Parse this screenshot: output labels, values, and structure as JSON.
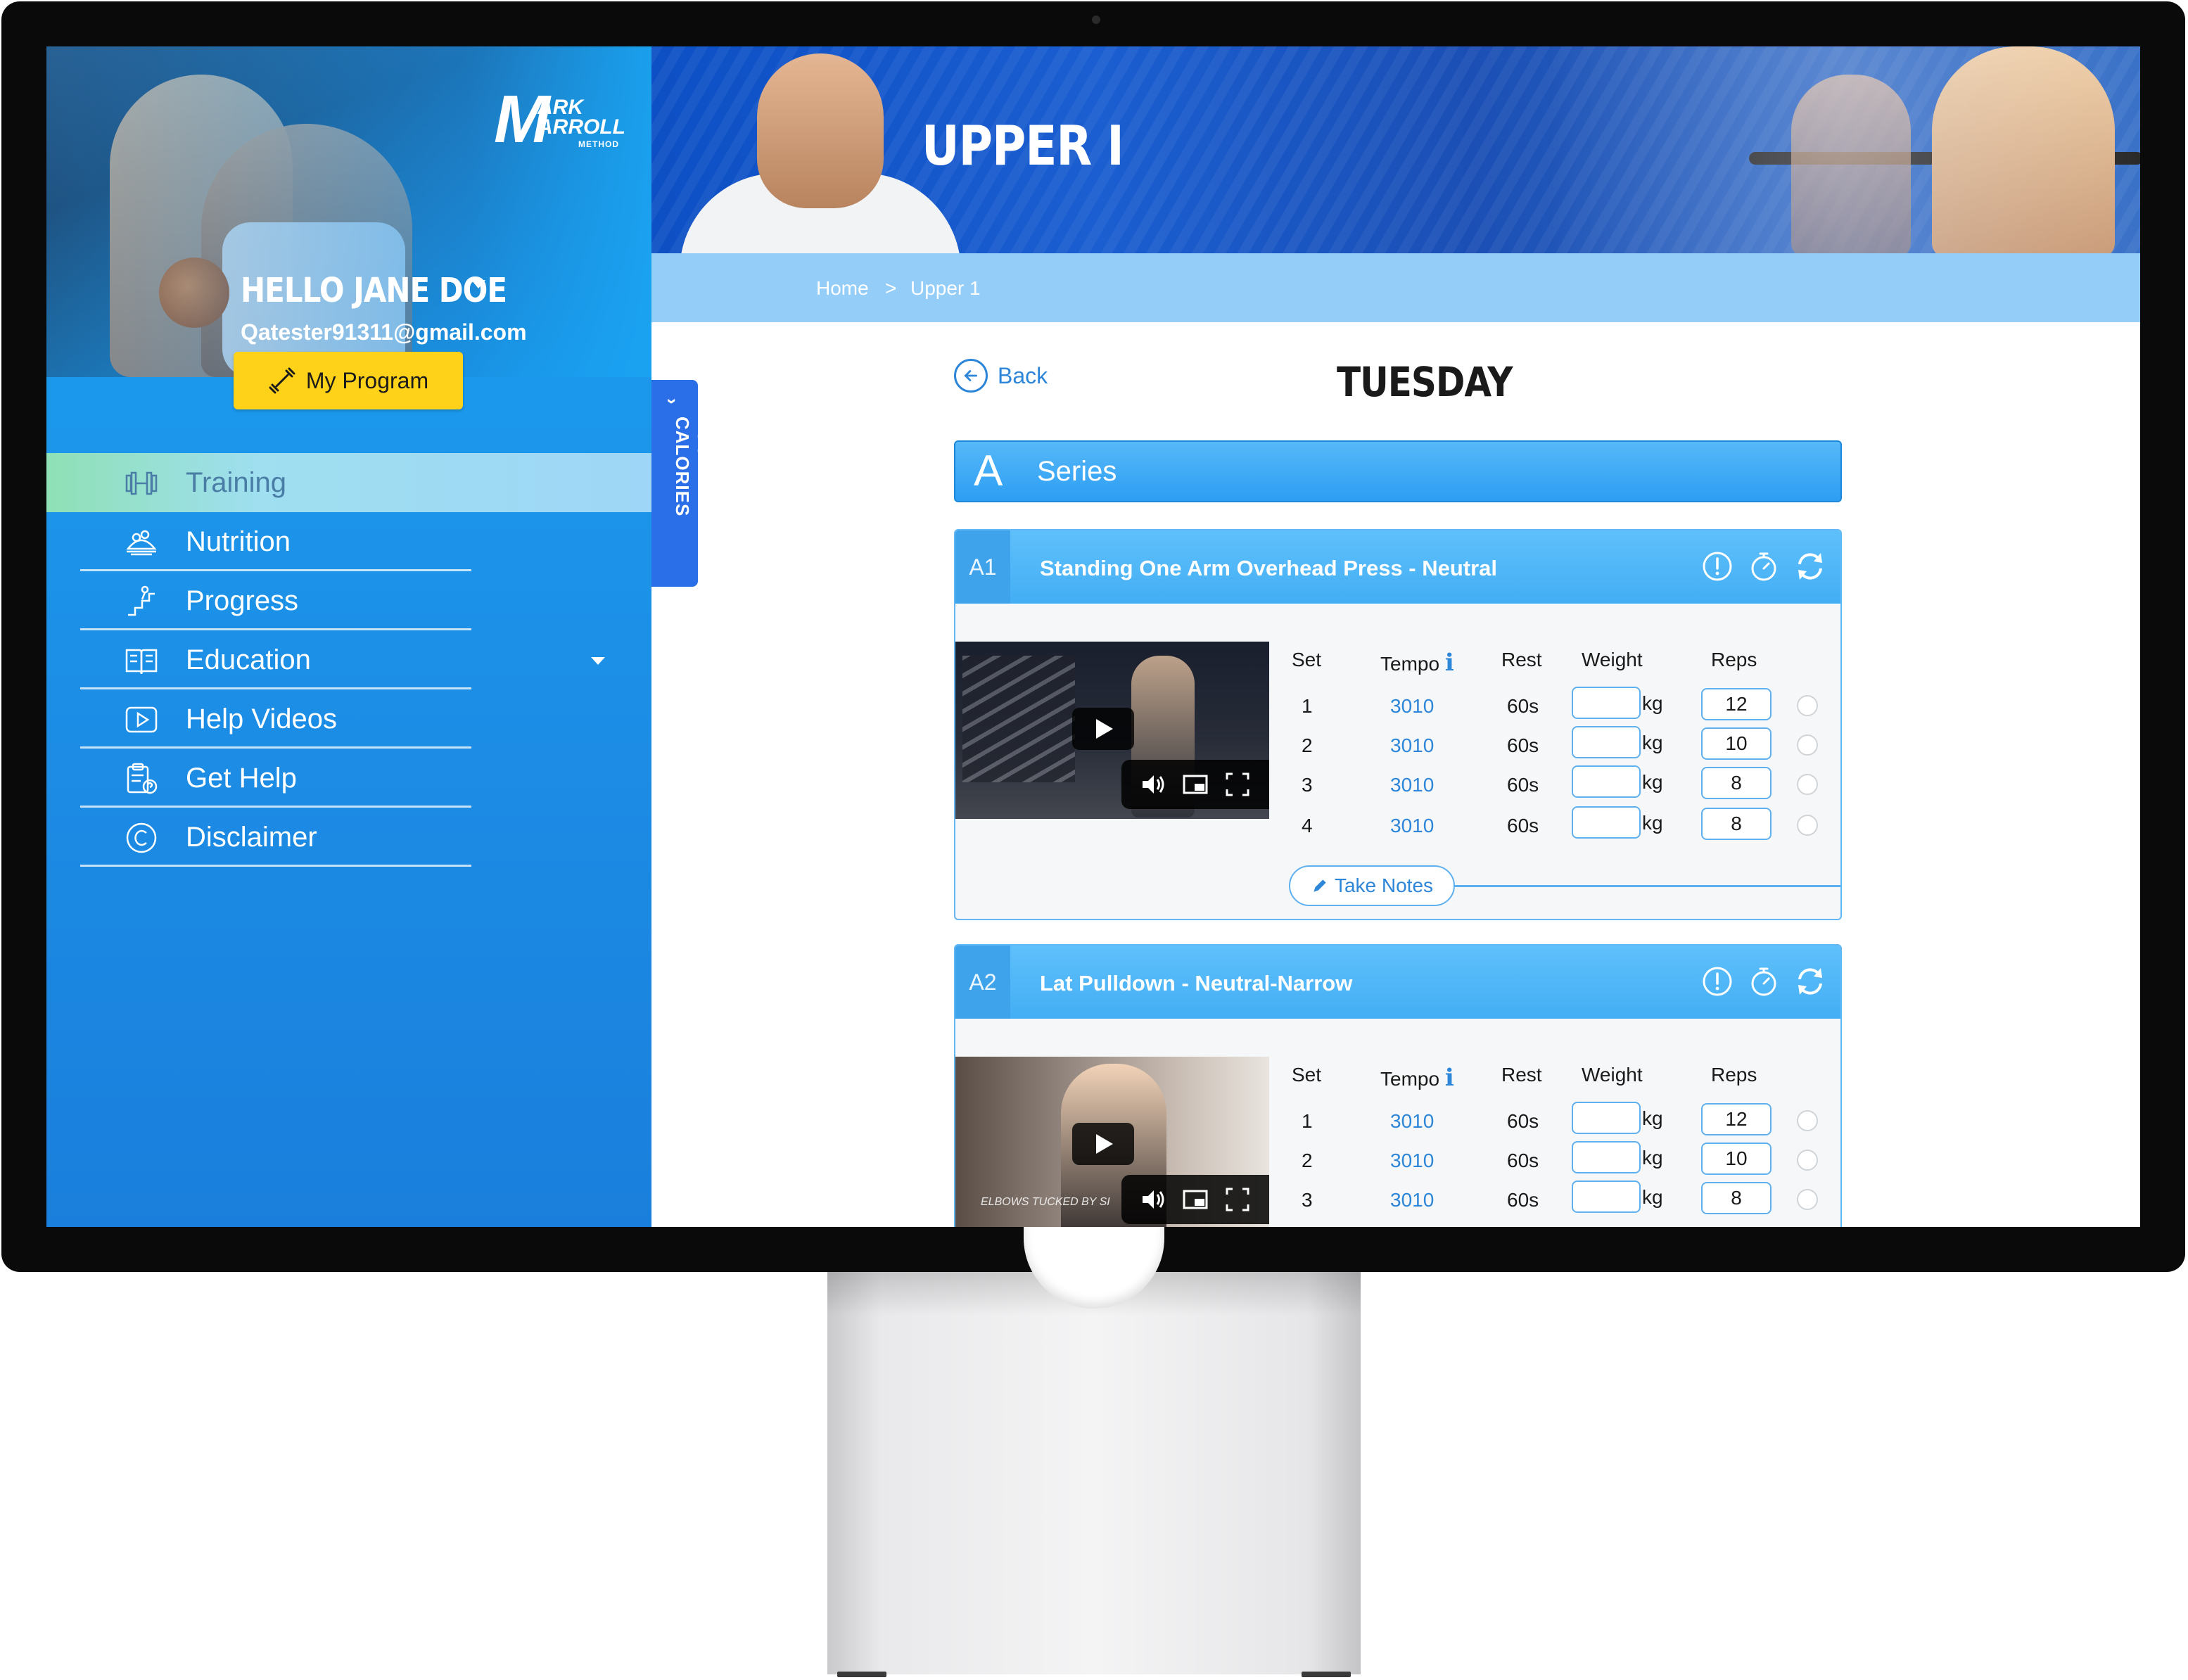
{
  "brand": {
    "logo_initial": "M",
    "logo_line1": "ARK",
    "logo_line2": "ARROLL",
    "logo_line3": "METHOD"
  },
  "user": {
    "greeting": "HELLO JANE DOE",
    "email": "Qatester91311@gmail.com",
    "program_button": "My Program"
  },
  "nav": {
    "items": [
      {
        "label": "Training",
        "icon": "dumbbell-icon",
        "active": true
      },
      {
        "label": "Nutrition",
        "icon": "food-icon"
      },
      {
        "label": "Progress",
        "icon": "progress-stairs-icon"
      },
      {
        "label": "Education",
        "icon": "book-icon",
        "has_dropdown": true
      },
      {
        "label": "Help Videos",
        "icon": "video-play-icon"
      },
      {
        "label": "Get Help",
        "icon": "clipboard-help-icon"
      },
      {
        "label": "Disclaimer",
        "icon": "copyright-icon"
      }
    ]
  },
  "page": {
    "banner_title": "UPPER I",
    "breadcrumb": {
      "home": "Home",
      "separator": ">",
      "current": "Upper 1"
    },
    "calories_tab": "YOUR CALORIES",
    "back_label": "Back",
    "day_title": "TUESDAY"
  },
  "series": {
    "letter": "A",
    "label": "Series"
  },
  "table_headers": {
    "set": "Set",
    "tempo": "Tempo",
    "tempo_info": "i",
    "rest": "Rest",
    "weight": "Weight",
    "reps": "Reps"
  },
  "weight_unit": "kg",
  "take_notes": "Take Notes",
  "exercises": [
    {
      "code": "A1",
      "name": "Standing One Arm Overhead Press - Neutral",
      "video_caption": "",
      "sets": [
        {
          "set": "1",
          "tempo": "3010",
          "rest": "60s",
          "weight": "",
          "reps": "12"
        },
        {
          "set": "2",
          "tempo": "3010",
          "rest": "60s",
          "weight": "",
          "reps": "10"
        },
        {
          "set": "3",
          "tempo": "3010",
          "rest": "60s",
          "weight": "",
          "reps": "8"
        },
        {
          "set": "4",
          "tempo": "3010",
          "rest": "60s",
          "weight": "",
          "reps": "8"
        }
      ]
    },
    {
      "code": "A2",
      "name": "Lat Pulldown - Neutral-Narrow",
      "video_caption": "ELBOWS TUCKED BY SI",
      "sets": [
        {
          "set": "1",
          "tempo": "3010",
          "rest": "60s",
          "weight": "",
          "reps": "12"
        },
        {
          "set": "2",
          "tempo": "3010",
          "rest": "60s",
          "weight": "",
          "reps": "10"
        },
        {
          "set": "3",
          "tempo": "3010",
          "rest": "60s",
          "weight": "",
          "reps": "8"
        }
      ]
    }
  ],
  "colors": {
    "sidebar": "#1c8ee6",
    "accent_blue": "#2e86d8",
    "program_button": "#ffd21a",
    "series_bar": "#2d9ef3",
    "crumb_bar": "#93cdf8"
  }
}
